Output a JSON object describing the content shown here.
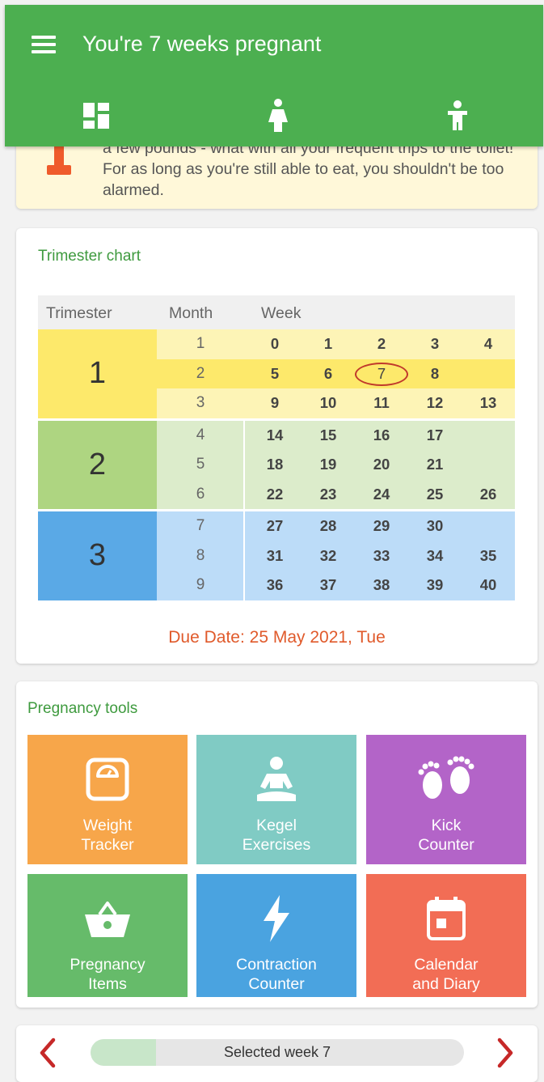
{
  "app_bar": {
    "title": "You're 7 weeks pregnant",
    "tabs": [
      {
        "icon": "dashboard-icon"
      },
      {
        "icon": "pregnant-woman-icon"
      },
      {
        "icon": "baby-icon"
      }
    ]
  },
  "tip": {
    "text": "a few pounds - what with all your frequent trips to the toilet! For as long as you're still able to eat, you shouldn't be too alarmed.",
    "icon": "scale-icon"
  },
  "trimester_chart": {
    "title": "Trimester chart",
    "headers": {
      "trimester": "Trimester",
      "month": "Month",
      "week": "Week"
    },
    "current_week": "7",
    "highlight_month": "2",
    "trimesters": [
      {
        "label": "1",
        "color": "#fde96b",
        "months": [
          {
            "month": "1",
            "weeks": [
              "0",
              "1",
              "2",
              "3",
              "4"
            ]
          },
          {
            "month": "2",
            "weeks": [
              "5",
              "6",
              "7",
              "8",
              ""
            ]
          },
          {
            "month": "3",
            "weeks": [
              "9",
              "10",
              "11",
              "12",
              "13"
            ]
          }
        ]
      },
      {
        "label": "2",
        "color": "#aed581",
        "months": [
          {
            "month": "4",
            "weeks": [
              "14",
              "15",
              "16",
              "17",
              ""
            ]
          },
          {
            "month": "5",
            "weeks": [
              "18",
              "19",
              "20",
              "21",
              ""
            ]
          },
          {
            "month": "6",
            "weeks": [
              "22",
              "23",
              "24",
              "25",
              "26"
            ]
          }
        ]
      },
      {
        "label": "3",
        "color": "#5aa9e6",
        "months": [
          {
            "month": "7",
            "weeks": [
              "27",
              "28",
              "29",
              "30",
              ""
            ]
          },
          {
            "month": "8",
            "weeks": [
              "31",
              "32",
              "33",
              "34",
              "35"
            ]
          },
          {
            "month": "9",
            "weeks": [
              "36",
              "37",
              "38",
              "39",
              "40"
            ]
          }
        ]
      }
    ],
    "due_date": "Due Date: 25 May 2021, Tue"
  },
  "tools": {
    "title": "Pregnancy tools",
    "items": [
      {
        "label": "Weight\nTracker",
        "icon": "weight-scale-icon"
      },
      {
        "label": "Kegel\nExercises",
        "icon": "meditation-icon"
      },
      {
        "label": "Kick\nCounter",
        "icon": "footprints-icon"
      },
      {
        "label": "Pregnancy\nItems",
        "icon": "basket-icon"
      },
      {
        "label": "Contraction\nCounter",
        "icon": "lightning-icon"
      },
      {
        "label": "Calendar\nand Diary",
        "icon": "calendar-icon"
      }
    ]
  },
  "week_selector": {
    "label": "Selected week 7",
    "week": 7,
    "total_weeks": 40
  }
}
